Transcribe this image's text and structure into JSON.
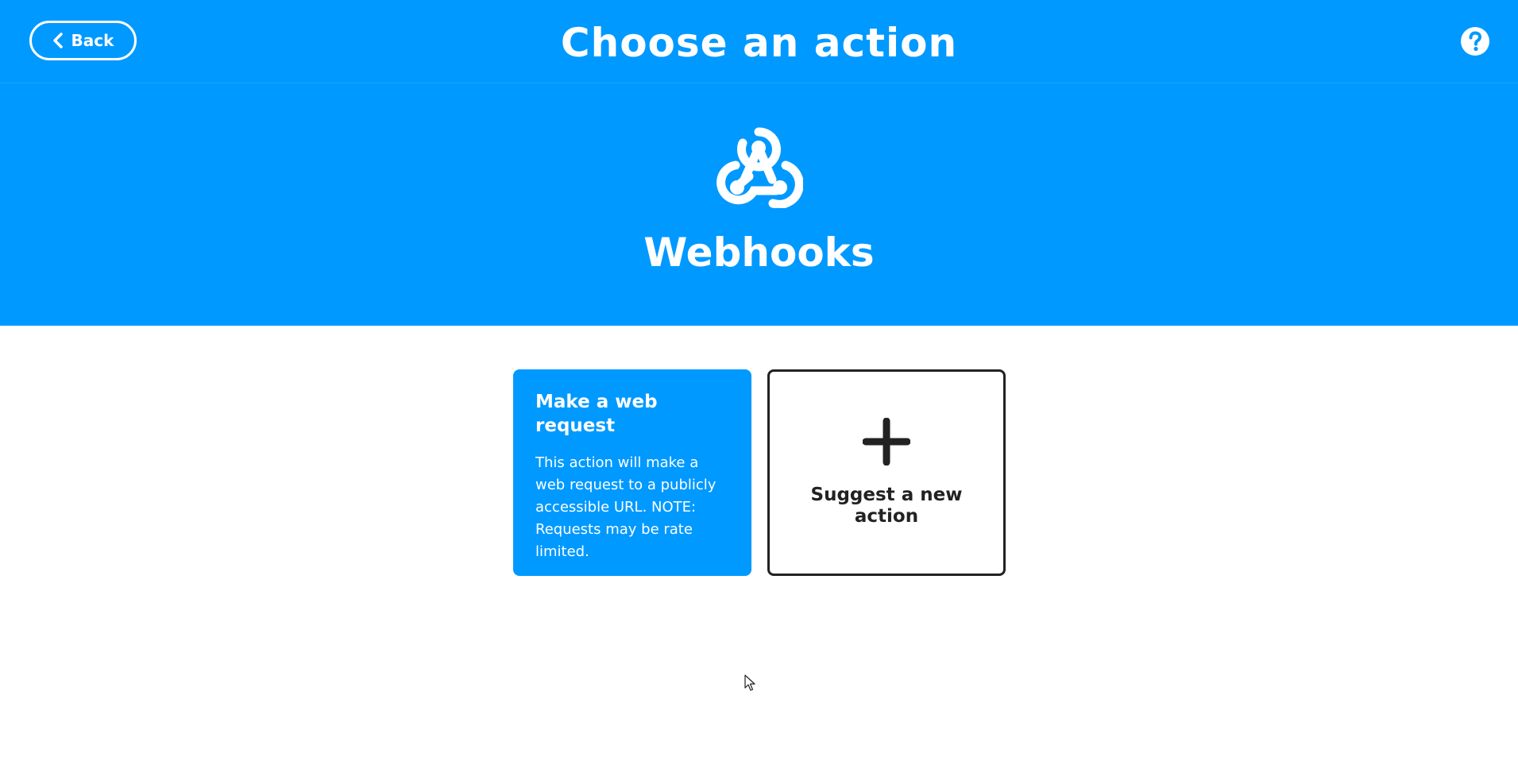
{
  "header": {
    "back_label": "Back",
    "title": "Choose an action",
    "help_icon": "help-icon"
  },
  "service": {
    "name": "Webhooks",
    "icon": "webhooks-icon"
  },
  "actions": [
    {
      "title": "Make a web request",
      "description": "This action will make a web request to a publicly accessible URL. NOTE: Requests may be rate limited."
    }
  ],
  "suggest": {
    "label": "Suggest a new action",
    "icon": "plus-icon"
  },
  "colors": {
    "brand_blue": "#0099ff",
    "text_dark": "#222222",
    "background": "#ffffff"
  }
}
